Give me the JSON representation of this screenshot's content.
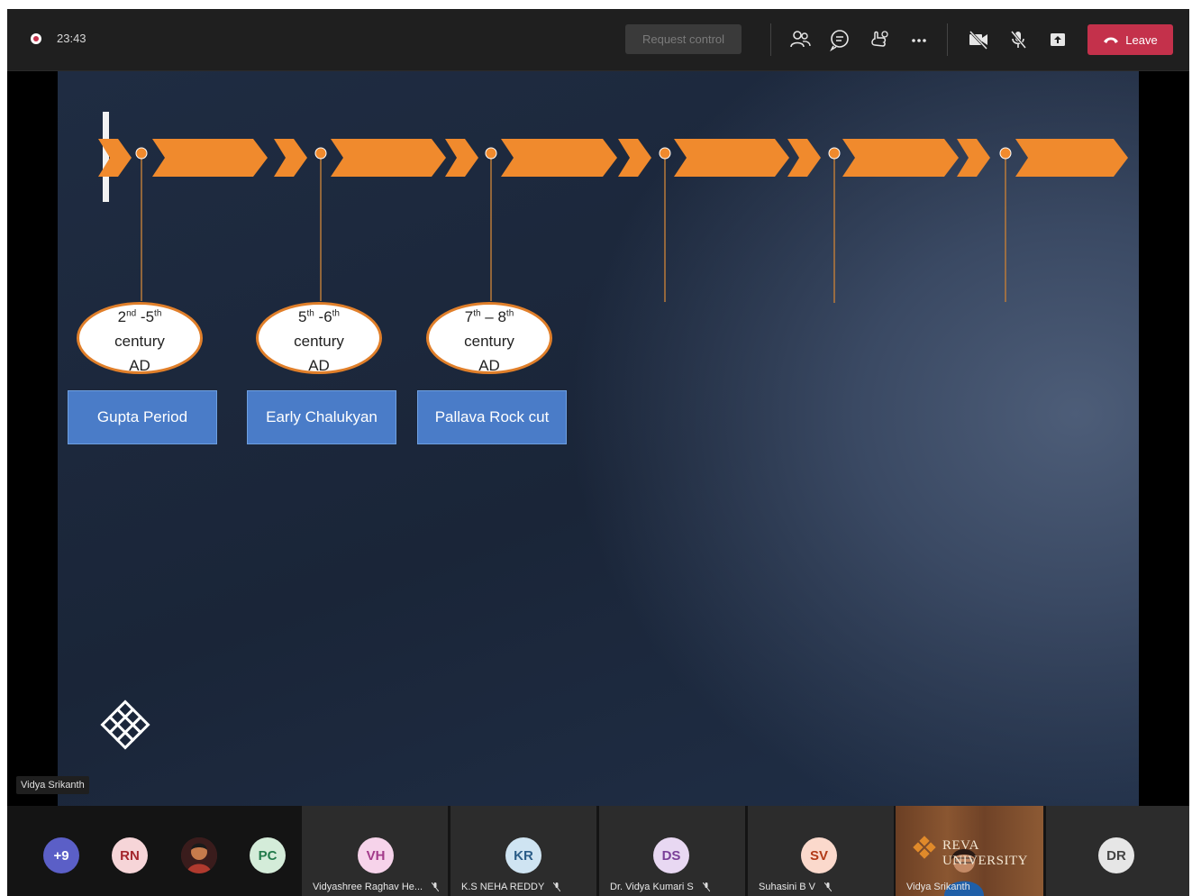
{
  "toolbar": {
    "timer": "23:43",
    "request_control": "Request control",
    "leave": "Leave"
  },
  "slide": {
    "eras": [
      {
        "from": "2",
        "from_sup": "nd",
        "sep": " -",
        "to": "5",
        "to_sup": "th",
        "line2": "century",
        "line3": "AD"
      },
      {
        "from": "5",
        "from_sup": "th",
        "sep": " -",
        "to": "6",
        "to_sup": "th",
        "line2": "century",
        "line3": "AD"
      },
      {
        "from": "7",
        "from_sup": "th",
        "sep": " – ",
        "to": "8",
        "to_sup": "th",
        "line2": "century",
        "line3": "AD"
      }
    ],
    "labels": [
      "Gupta Period",
      "Early Chalukyan",
      "Pallava Rock cut"
    ]
  },
  "presenter_name": "Vidya Srikanth",
  "participants": [
    {
      "initials": "+9",
      "bg": "#5b5fc7",
      "fg": "#ffffff"
    },
    {
      "initials": "RN",
      "bg": "#f6d5d8",
      "fg": "#a4262c"
    },
    {
      "initials": "",
      "bg": "#5a2a2a",
      "fg": "#ffffff"
    },
    {
      "initials": "PC",
      "bg": "#d4ecd9",
      "fg": "#237b4b"
    }
  ],
  "named_participants": [
    {
      "initials": "VH",
      "name": "Vidyashree Raghav He...",
      "bg": "#f6d3ea",
      "fg": "#a33b8a"
    },
    {
      "initials": "KR",
      "name": "K.S NEHA REDDY",
      "bg": "#cfe4f2",
      "fg": "#2b5d88"
    },
    {
      "initials": "DS",
      "name": "Dr. Vidya Kumari S",
      "bg": "#e8d8f2",
      "fg": "#7a3f98"
    },
    {
      "initials": "SV",
      "name": "Suhasini B V",
      "bg": "#fbd9cc",
      "fg": "#b23a17"
    }
  ],
  "video_tile": {
    "name": "Vidya Srikanth",
    "logo_text": "REVA UNIVERSITY"
  },
  "last_participant": {
    "initials": "DR",
    "bg": "#e6e6e6",
    "fg": "#444444"
  },
  "colors": {
    "accent_orange": "#f08a2d",
    "label_blue": "#4a7cc8",
    "leave_red": "#c4314b"
  },
  "icons": [
    "record-icon",
    "participants-icon",
    "chat-icon",
    "reactions-icon",
    "more-icon",
    "camera-off-icon",
    "mic-off-icon",
    "share-icon",
    "phone-icon",
    "knot-logo-icon"
  ]
}
